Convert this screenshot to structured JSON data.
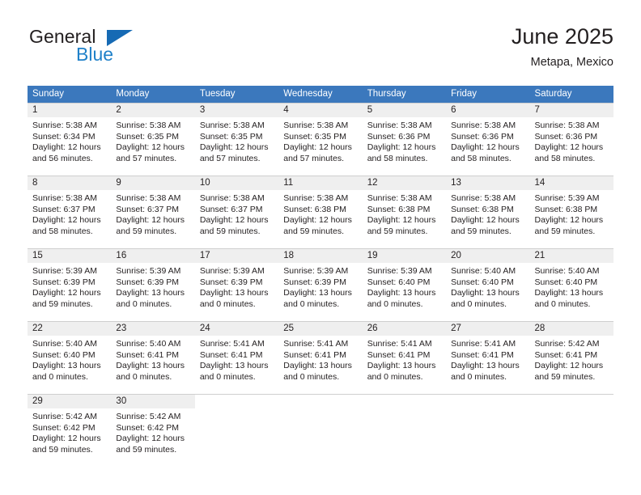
{
  "brand": {
    "name_top": "General",
    "name_bottom": "Blue",
    "triangle_color": "#166ab4",
    "blue_text_color": "#2081c9"
  },
  "header": {
    "title": "June 2025",
    "subtitle": "Metapa, Mexico"
  },
  "theme": {
    "header_blue": "#3b78bd",
    "daynum_gray": "#efefef",
    "text": "#231f20"
  },
  "weekdays": [
    "Sunday",
    "Monday",
    "Tuesday",
    "Wednesday",
    "Thursday",
    "Friday",
    "Saturday"
  ],
  "weeks": [
    [
      {
        "day": "1",
        "sunrise": "Sunrise: 5:38 AM",
        "sunset": "Sunset: 6:34 PM",
        "daylight1": "Daylight: 12 hours",
        "daylight2": "and 56 minutes."
      },
      {
        "day": "2",
        "sunrise": "Sunrise: 5:38 AM",
        "sunset": "Sunset: 6:35 PM",
        "daylight1": "Daylight: 12 hours",
        "daylight2": "and 57 minutes."
      },
      {
        "day": "3",
        "sunrise": "Sunrise: 5:38 AM",
        "sunset": "Sunset: 6:35 PM",
        "daylight1": "Daylight: 12 hours",
        "daylight2": "and 57 minutes."
      },
      {
        "day": "4",
        "sunrise": "Sunrise: 5:38 AM",
        "sunset": "Sunset: 6:35 PM",
        "daylight1": "Daylight: 12 hours",
        "daylight2": "and 57 minutes."
      },
      {
        "day": "5",
        "sunrise": "Sunrise: 5:38 AM",
        "sunset": "Sunset: 6:36 PM",
        "daylight1": "Daylight: 12 hours",
        "daylight2": "and 58 minutes."
      },
      {
        "day": "6",
        "sunrise": "Sunrise: 5:38 AM",
        "sunset": "Sunset: 6:36 PM",
        "daylight1": "Daylight: 12 hours",
        "daylight2": "and 58 minutes."
      },
      {
        "day": "7",
        "sunrise": "Sunrise: 5:38 AM",
        "sunset": "Sunset: 6:36 PM",
        "daylight1": "Daylight: 12 hours",
        "daylight2": "and 58 minutes."
      }
    ],
    [
      {
        "day": "8",
        "sunrise": "Sunrise: 5:38 AM",
        "sunset": "Sunset: 6:37 PM",
        "daylight1": "Daylight: 12 hours",
        "daylight2": "and 58 minutes."
      },
      {
        "day": "9",
        "sunrise": "Sunrise: 5:38 AM",
        "sunset": "Sunset: 6:37 PM",
        "daylight1": "Daylight: 12 hours",
        "daylight2": "and 59 minutes."
      },
      {
        "day": "10",
        "sunrise": "Sunrise: 5:38 AM",
        "sunset": "Sunset: 6:37 PM",
        "daylight1": "Daylight: 12 hours",
        "daylight2": "and 59 minutes."
      },
      {
        "day": "11",
        "sunrise": "Sunrise: 5:38 AM",
        "sunset": "Sunset: 6:38 PM",
        "daylight1": "Daylight: 12 hours",
        "daylight2": "and 59 minutes."
      },
      {
        "day": "12",
        "sunrise": "Sunrise: 5:38 AM",
        "sunset": "Sunset: 6:38 PM",
        "daylight1": "Daylight: 12 hours",
        "daylight2": "and 59 minutes."
      },
      {
        "day": "13",
        "sunrise": "Sunrise: 5:38 AM",
        "sunset": "Sunset: 6:38 PM",
        "daylight1": "Daylight: 12 hours",
        "daylight2": "and 59 minutes."
      },
      {
        "day": "14",
        "sunrise": "Sunrise: 5:39 AM",
        "sunset": "Sunset: 6:38 PM",
        "daylight1": "Daylight: 12 hours",
        "daylight2": "and 59 minutes."
      }
    ],
    [
      {
        "day": "15",
        "sunrise": "Sunrise: 5:39 AM",
        "sunset": "Sunset: 6:39 PM",
        "daylight1": "Daylight: 12 hours",
        "daylight2": "and 59 minutes."
      },
      {
        "day": "16",
        "sunrise": "Sunrise: 5:39 AM",
        "sunset": "Sunset: 6:39 PM",
        "daylight1": "Daylight: 13 hours",
        "daylight2": "and 0 minutes."
      },
      {
        "day": "17",
        "sunrise": "Sunrise: 5:39 AM",
        "sunset": "Sunset: 6:39 PM",
        "daylight1": "Daylight: 13 hours",
        "daylight2": "and 0 minutes."
      },
      {
        "day": "18",
        "sunrise": "Sunrise: 5:39 AM",
        "sunset": "Sunset: 6:39 PM",
        "daylight1": "Daylight: 13 hours",
        "daylight2": "and 0 minutes."
      },
      {
        "day": "19",
        "sunrise": "Sunrise: 5:39 AM",
        "sunset": "Sunset: 6:40 PM",
        "daylight1": "Daylight: 13 hours",
        "daylight2": "and 0 minutes."
      },
      {
        "day": "20",
        "sunrise": "Sunrise: 5:40 AM",
        "sunset": "Sunset: 6:40 PM",
        "daylight1": "Daylight: 13 hours",
        "daylight2": "and 0 minutes."
      },
      {
        "day": "21",
        "sunrise": "Sunrise: 5:40 AM",
        "sunset": "Sunset: 6:40 PM",
        "daylight1": "Daylight: 13 hours",
        "daylight2": "and 0 minutes."
      }
    ],
    [
      {
        "day": "22",
        "sunrise": "Sunrise: 5:40 AM",
        "sunset": "Sunset: 6:40 PM",
        "daylight1": "Daylight: 13 hours",
        "daylight2": "and 0 minutes."
      },
      {
        "day": "23",
        "sunrise": "Sunrise: 5:40 AM",
        "sunset": "Sunset: 6:41 PM",
        "daylight1": "Daylight: 13 hours",
        "daylight2": "and 0 minutes."
      },
      {
        "day": "24",
        "sunrise": "Sunrise: 5:41 AM",
        "sunset": "Sunset: 6:41 PM",
        "daylight1": "Daylight: 13 hours",
        "daylight2": "and 0 minutes."
      },
      {
        "day": "25",
        "sunrise": "Sunrise: 5:41 AM",
        "sunset": "Sunset: 6:41 PM",
        "daylight1": "Daylight: 13 hours",
        "daylight2": "and 0 minutes."
      },
      {
        "day": "26",
        "sunrise": "Sunrise: 5:41 AM",
        "sunset": "Sunset: 6:41 PM",
        "daylight1": "Daylight: 13 hours",
        "daylight2": "and 0 minutes."
      },
      {
        "day": "27",
        "sunrise": "Sunrise: 5:41 AM",
        "sunset": "Sunset: 6:41 PM",
        "daylight1": "Daylight: 13 hours",
        "daylight2": "and 0 minutes."
      },
      {
        "day": "28",
        "sunrise": "Sunrise: 5:42 AM",
        "sunset": "Sunset: 6:41 PM",
        "daylight1": "Daylight: 12 hours",
        "daylight2": "and 59 minutes."
      }
    ],
    [
      {
        "day": "29",
        "sunrise": "Sunrise: 5:42 AM",
        "sunset": "Sunset: 6:42 PM",
        "daylight1": "Daylight: 12 hours",
        "daylight2": "and 59 minutes."
      },
      {
        "day": "30",
        "sunrise": "Sunrise: 5:42 AM",
        "sunset": "Sunset: 6:42 PM",
        "daylight1": "Daylight: 12 hours",
        "daylight2": "and 59 minutes."
      },
      {
        "day": "",
        "sunrise": "",
        "sunset": "",
        "daylight1": "",
        "daylight2": ""
      },
      {
        "day": "",
        "sunrise": "",
        "sunset": "",
        "daylight1": "",
        "daylight2": ""
      },
      {
        "day": "",
        "sunrise": "",
        "sunset": "",
        "daylight1": "",
        "daylight2": ""
      },
      {
        "day": "",
        "sunrise": "",
        "sunset": "",
        "daylight1": "",
        "daylight2": ""
      },
      {
        "day": "",
        "sunrise": "",
        "sunset": "",
        "daylight1": "",
        "daylight2": ""
      }
    ]
  ]
}
